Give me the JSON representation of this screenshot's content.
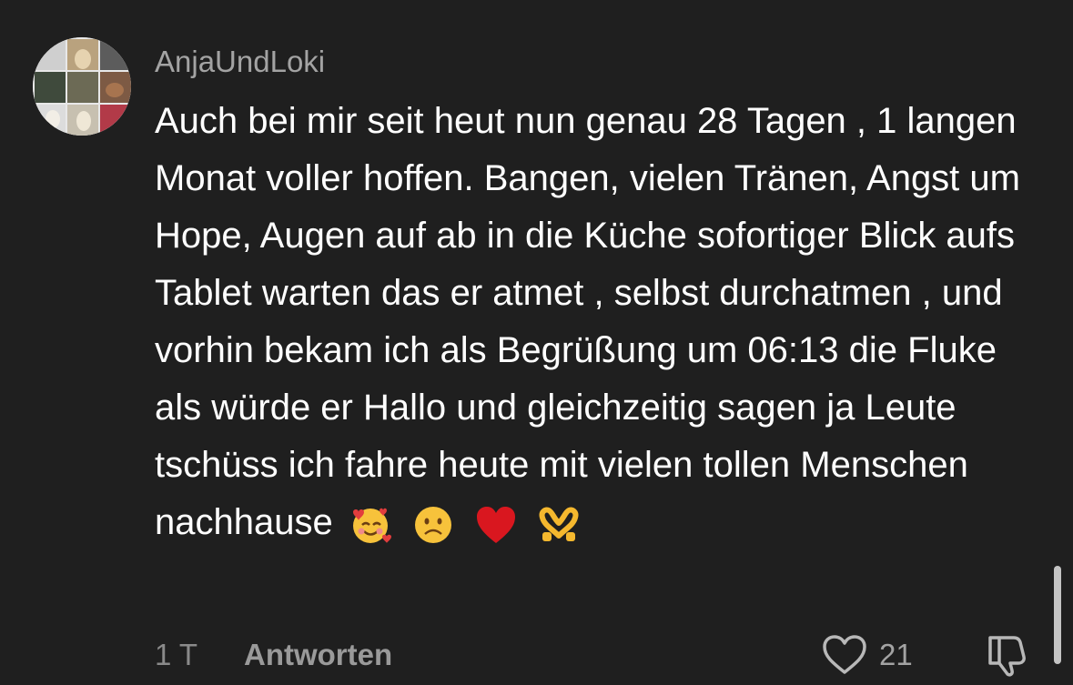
{
  "comment": {
    "username": "AnjaUndLoki",
    "text": "Auch bei mir seit heut nun genau 28 Tagen , 1 langen Monat voller hoffen. Bangen, vielen Tränen, Angst um Hope, Augen auf ab in die Küche sofortiger Blick aufs Tablet warten das er atmet , selbst durchatmen , und vorhin bekam ich als Begrüßung um 06:13 die Fluke als würde er Hallo und gleichzeitig sagen ja Leute tschüss ich fahre heute mit vielen tollen Menschen nachhause",
    "emojis": [
      "smiling-face-with-hearts",
      "frowning-face",
      "red-heart",
      "heart-hands"
    ],
    "timestamp": "1 T",
    "reply_label": "Antworten",
    "like_count": "21"
  },
  "icons": {
    "like": "heart-outline-icon",
    "dislike": "thumbs-down-icon"
  },
  "colors": {
    "background": "#1f1f1f",
    "text": "#ffffff",
    "muted": "#a3a3a3"
  }
}
